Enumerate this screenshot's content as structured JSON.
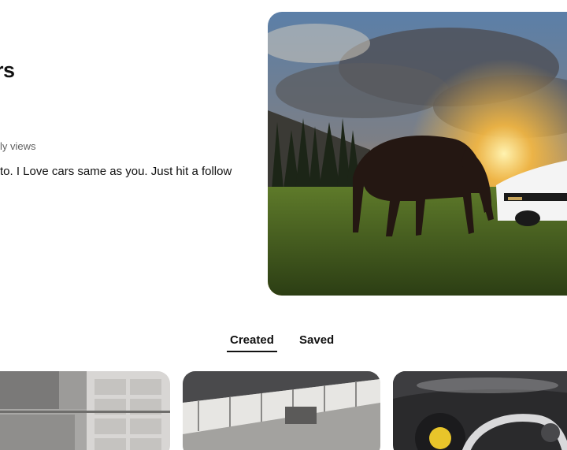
{
  "profile": {
    "title_fragment": "rs",
    "views_fragment": "ly views",
    "bio_fragment": "to. I Love cars same as you. Just hit a follow"
  },
  "hero": {
    "description_icon": "horse-and-car-image"
  },
  "tabs": [
    {
      "label": "Created",
      "active": true
    },
    {
      "label": "Saved",
      "active": false
    }
  ],
  "pins": [
    {
      "icon": "building-image"
    },
    {
      "icon": "building-balcony-image"
    },
    {
      "icon": "car-interior-image"
    }
  ],
  "colors": {
    "text_primary": "#111111",
    "text_secondary": "#5f5f5f",
    "tab_underline": "#111111"
  }
}
